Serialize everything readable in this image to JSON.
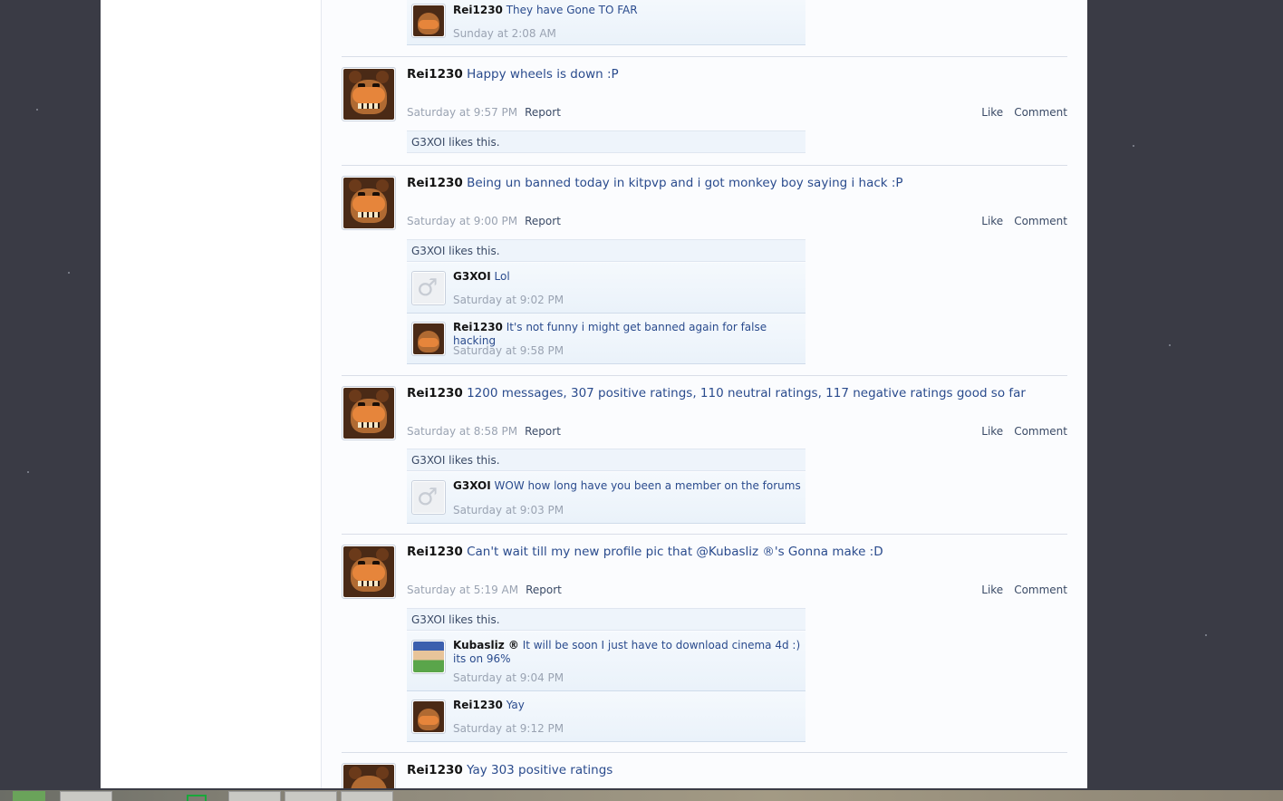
{
  "posts": [
    {
      "author": "Rei1230",
      "text": "Happy wheels is down :P",
      "time": "Saturday at 9:57 PM",
      "likes": "G3XOI likes this.",
      "comments": []
    },
    {
      "author": "Rei1230",
      "text": "Being un banned today in kitpvp and i got monkey boy saying i hack :P",
      "time": "Saturday at 9:00 PM",
      "likes": "G3XOI likes this.",
      "comments": [
        {
          "author": "G3XOI",
          "text": "Lol",
          "time": "Saturday at 9:02 PM"
        },
        {
          "author": "Rei1230",
          "text": "It's not funny i might get banned again for false hacking",
          "time": "Saturday at 9:58 PM"
        }
      ]
    },
    {
      "author": "Rei1230",
      "text": "1200 messages, 307 positive ratings, 110 neutral ratings, 117 negative ratings good so far",
      "time": "Saturday at 8:58 PM",
      "likes": "G3XOI likes this.",
      "comments": [
        {
          "author": "G3XOI",
          "text": "WOW how long have you been a member on the forums",
          "time": "Saturday at 9:03 PM"
        }
      ]
    },
    {
      "author": "Rei1230",
      "text": "Can't wait till my new profile pic that @Kubasliz ®'s Gonna make :D",
      "time": "Saturday at 5:19 AM",
      "likes": "G3XOI likes this.",
      "comments": [
        {
          "author": "Kubasliz ®",
          "text": "It will be soon I just have to download cinema 4d :) its on 96%",
          "time": "Saturday at 9:04 PM"
        },
        {
          "author": "Rei1230",
          "text": "Yay",
          "time": "Saturday at 9:12 PM"
        }
      ]
    },
    {
      "author": "Rei1230",
      "text": "Yay 303 positive ratings"
    }
  ],
  "top_comment": {
    "author": "Rei1230",
    "text": "They have Gone TO FAR",
    "time": "Sunday at 2:08 AM"
  },
  "labels": {
    "report": "Report",
    "like": "Like",
    "comment": "Comment"
  },
  "icons": {
    "avatar_rei": "freddy-bear-avatar",
    "avatar_g3xoi": "male-symbol-avatar",
    "avatar_kubasliz": "minecraft-character-avatar"
  },
  "colors": {
    "name": "#141414",
    "link": "#2a4b8d",
    "meta": "#9aa3b2",
    "comment_bg": "#eef4fb"
  }
}
